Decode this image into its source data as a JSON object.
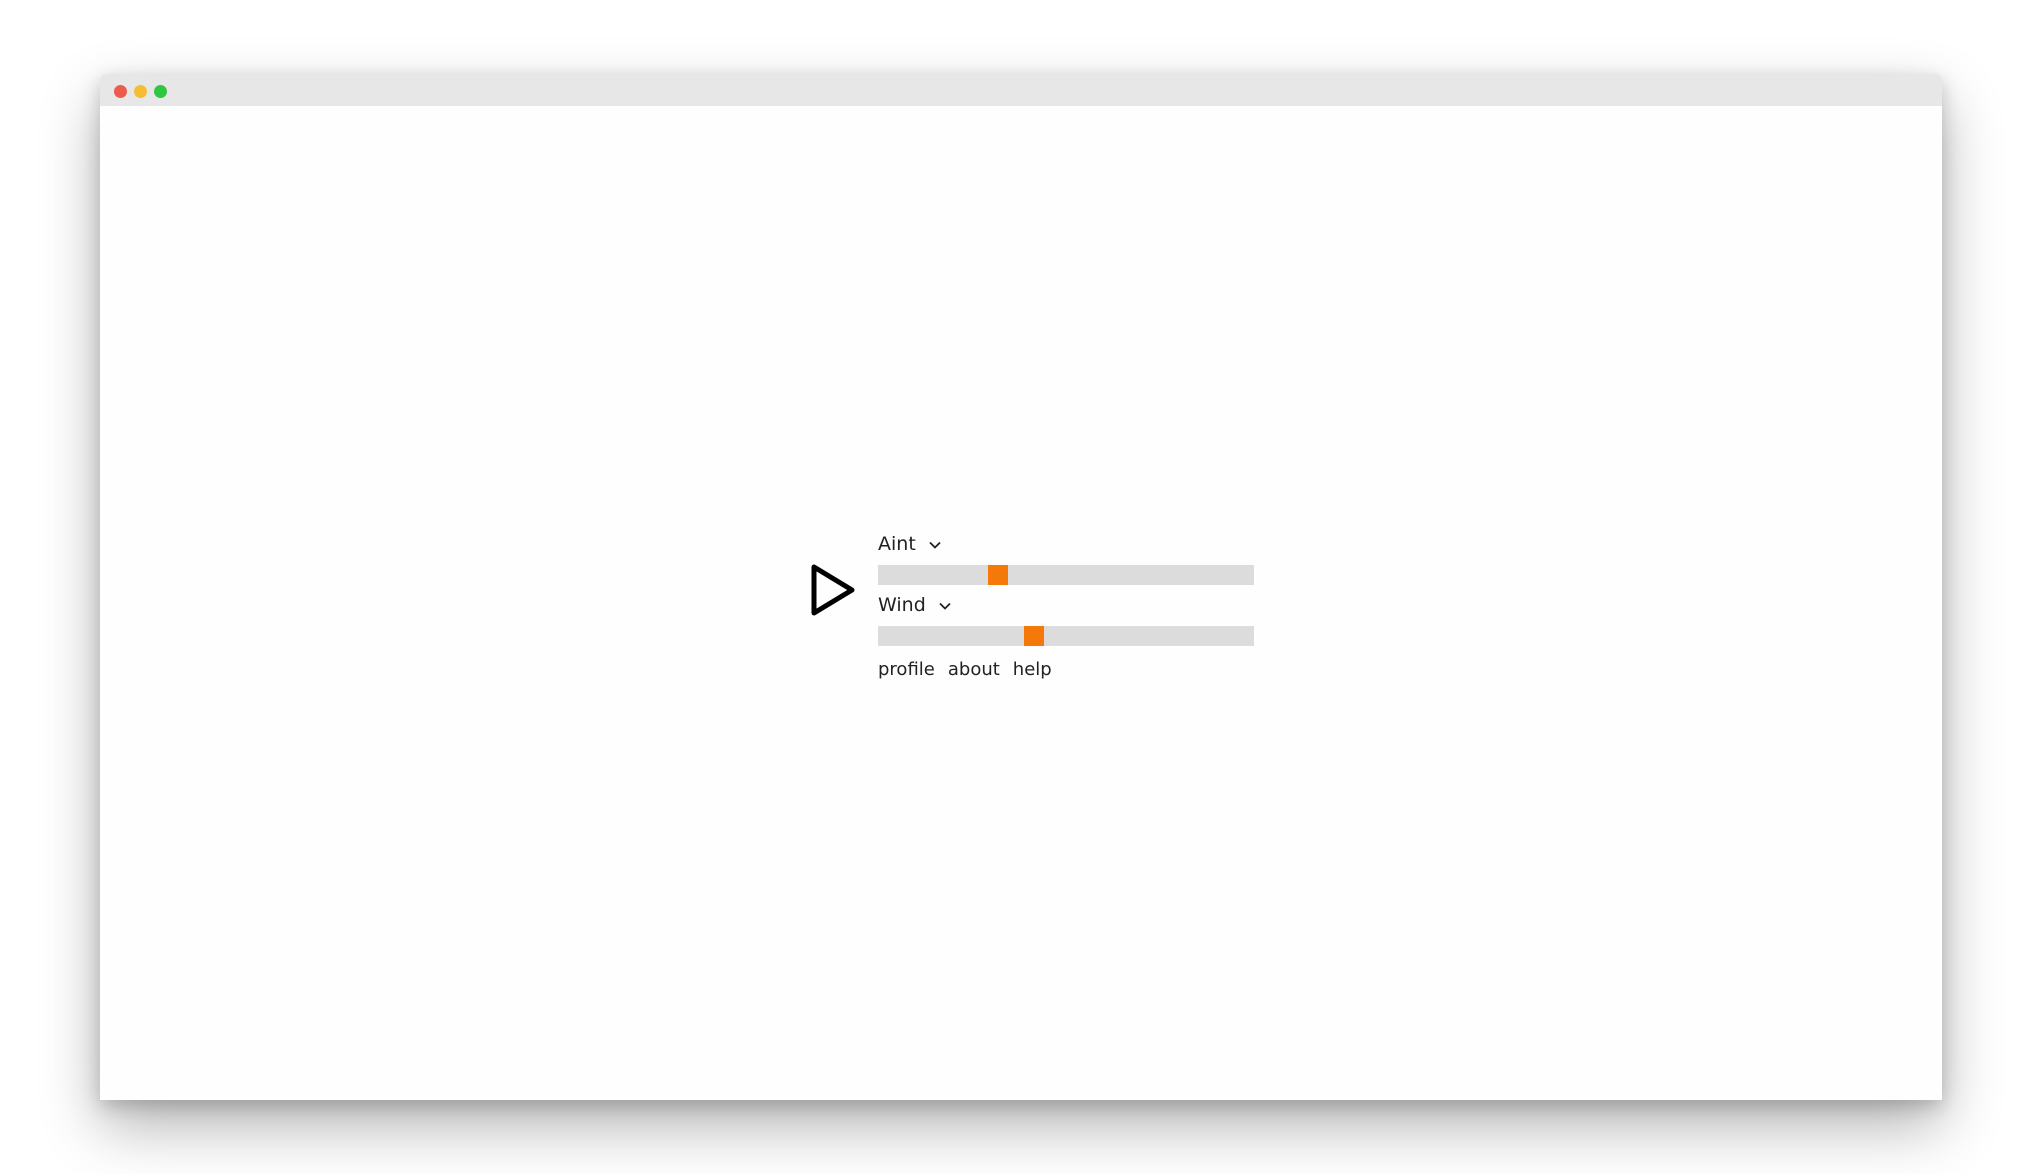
{
  "window": {
    "traffic_lights": {
      "close_color": "#ee5a4f",
      "minimize_color": "#f5bd33",
      "maximize_color": "#2ec740"
    }
  },
  "player": {
    "play_icon": "play-icon",
    "controls": [
      {
        "label": "Aint",
        "dropdown_icon": "chevron-down-icon",
        "value_fraction": 0.32
      },
      {
        "label": "Wind",
        "dropdown_icon": "chevron-down-icon",
        "value_fraction": 0.415
      }
    ],
    "slider_track_color": "#dcdcdc",
    "slider_thumb_color": "#f5780a"
  },
  "nav": {
    "links": [
      "profile",
      "about",
      "help"
    ]
  }
}
